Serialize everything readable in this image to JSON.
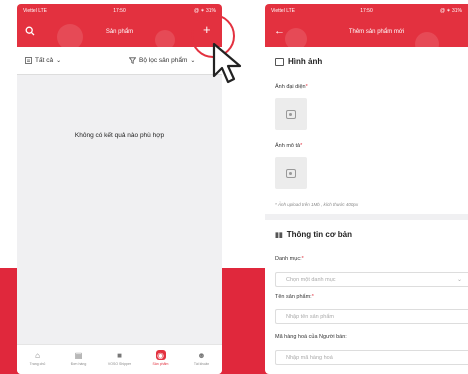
{
  "left_screen": {
    "status": {
      "carrier": "Viettel  LTE",
      "time": "17:50",
      "right": "@ ✶ 31%"
    },
    "header": {
      "title": "Sản phẩm",
      "search_icon": "search-icon",
      "add_icon": "plus-icon"
    },
    "filter": {
      "all_label": "Tất cả",
      "filter_label": "Bộ lọc sản phẩm"
    },
    "empty_message": "Không có kết quả nào phù hợp",
    "tabs": [
      {
        "label": "Trang chủ",
        "icon": "home-icon"
      },
      {
        "label": "Đơn hàng",
        "icon": "document-icon"
      },
      {
        "label": "VOSO Shipper",
        "icon": "truck-icon"
      },
      {
        "label": "Sản phẩm",
        "icon": "product-icon"
      },
      {
        "label": "Tài khoản",
        "icon": "user-icon"
      }
    ],
    "active_tab": "Sản phẩm"
  },
  "right_screen": {
    "status": {
      "carrier": "Viettel  LTE",
      "time": "17:50",
      "right": "@ ✶ 31%"
    },
    "header": {
      "title": "Thêm sản phẩm mới",
      "back_icon": "back-arrow-icon"
    },
    "images_section": {
      "title": "Hình ảnh",
      "avatar_label": "Ảnh đại diện",
      "desc_label": "Ảnh mô tả",
      "required_mark": "*",
      "hint": "* Ảnh upload trên 1Mb , kích thước 400px"
    },
    "basic_section": {
      "title": "Thông tin cơ bản",
      "category_label": "Danh mục:",
      "category_placeholder": "Chọn một danh mục",
      "name_label": "Tên sản phẩm:",
      "name_placeholder": "Nhập tên sản phẩm",
      "sku_label": "Mã hàng hoá của Người bán:",
      "sku_placeholder": "Nhập mã hàng hoá"
    }
  },
  "colors": {
    "brand_red": "#e3313f",
    "band_red": "#e0283c",
    "bg_gray": "#f0f0f2"
  }
}
